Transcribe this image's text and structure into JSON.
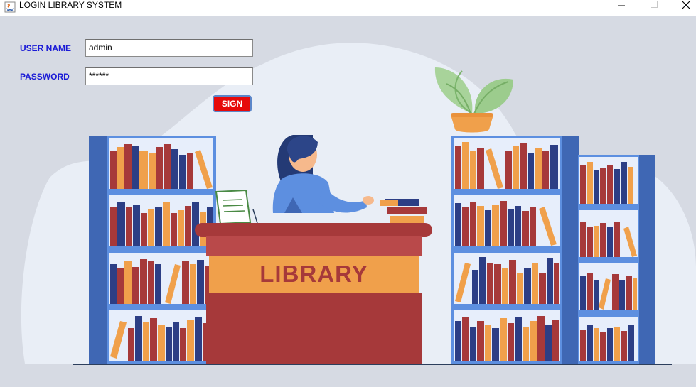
{
  "window": {
    "title": "LOGIN LIBRARY SYSTEM",
    "icons": [
      "java-app-icon",
      "minimize-icon",
      "maximize-icon",
      "close-icon"
    ]
  },
  "form": {
    "username_label": "USER NAME",
    "username_value": "admin",
    "password_label": "PASSWORD",
    "password_value": "******",
    "sign_label": "SIGN"
  },
  "illustration": {
    "desk_sign": "LIBRARY"
  },
  "colors": {
    "label_blue": "#1a1ad6",
    "button_red": "#e60a0a",
    "desk_red": "#a6393a",
    "desk_orange": "#f0a04b",
    "shelf_blue": "#3f67b4",
    "book_navy": "#2c3e85",
    "background": "#d6dae3"
  }
}
